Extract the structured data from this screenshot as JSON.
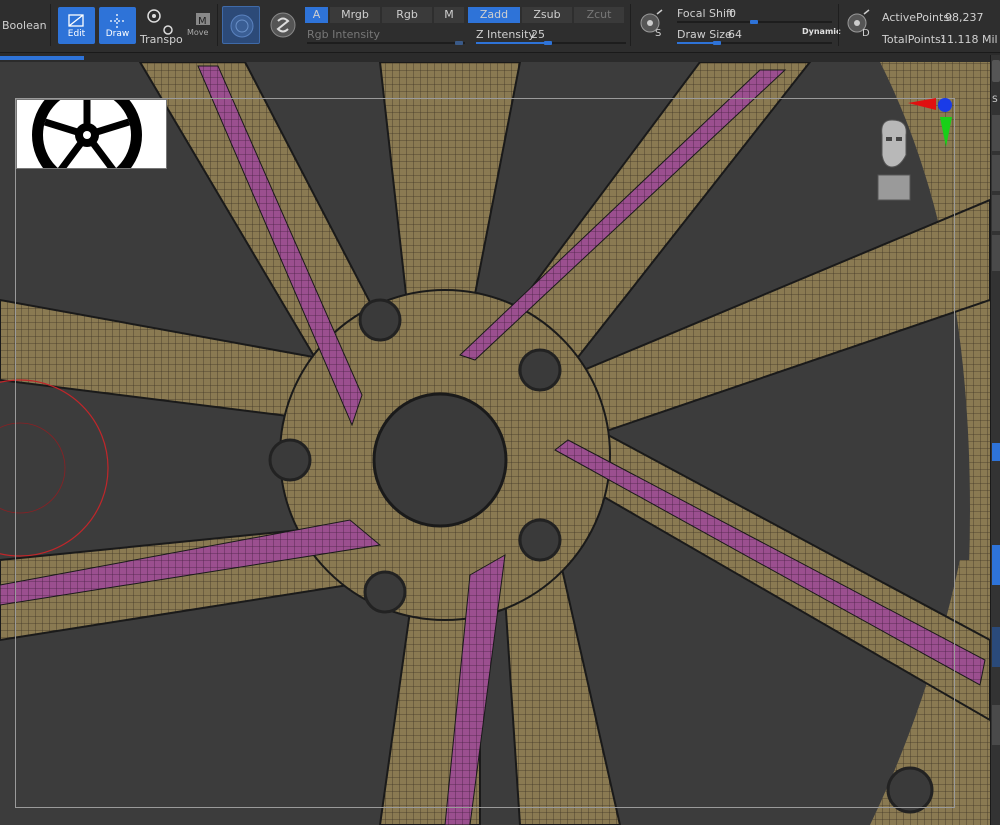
{
  "toolbar": {
    "boolean_label": "Boolean",
    "edit_label": "Edit",
    "draw_label": "Draw",
    "transpose_label": "Transpo",
    "move_label": "Move",
    "a_label": "A",
    "mrgb_label": "Mrgb",
    "rgb_label": "Rgb",
    "m_label": "M",
    "zadd_label": "Zadd",
    "zsub_label": "Zsub",
    "zcut_label": "Zcut",
    "rgb_intensity_label": "Rgb Intensity",
    "z_intensity_label": "Z Intensity",
    "z_intensity_value": "25",
    "focal_shift_label": "Focal Shift",
    "focal_shift_value": "0",
    "draw_size_label": "Draw Size",
    "draw_size_value": "64",
    "dynamic_label": "Dynamic",
    "s_label": "S",
    "d_label": "D",
    "active_points_label": "ActivePoints:",
    "active_points_value": "98,237",
    "total_points_label": "TotalPoints:",
    "total_points_value": "11.118 Mil"
  },
  "colors": {
    "accent": "#2e73d8",
    "mesh": "#8a7a52",
    "mask": "#9b4f8f",
    "background": "#3a3a3a"
  },
  "right_strip": {
    "letter": "S"
  }
}
